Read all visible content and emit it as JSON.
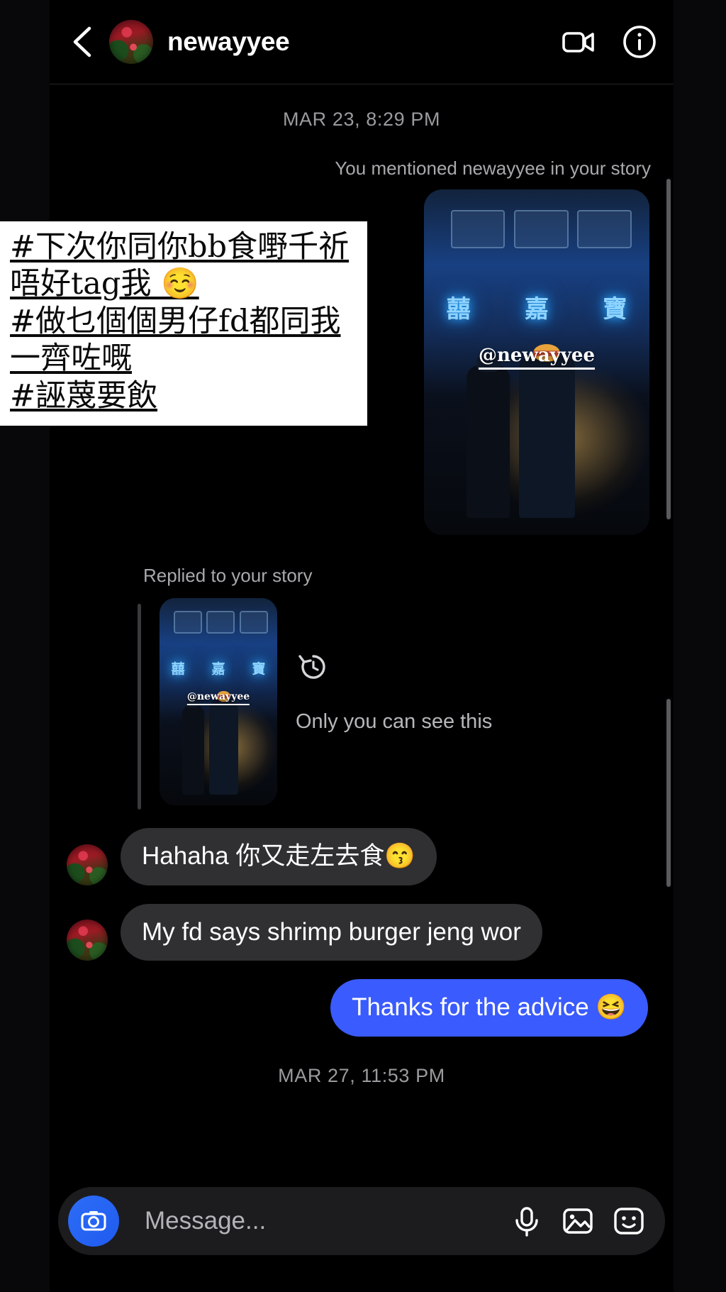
{
  "app": {
    "platform": "instagram-direct-message",
    "background_color": "#000000",
    "accent_color": "#3a5bfd"
  },
  "header": {
    "back_icon": "chevron-left-icon",
    "avatar_icon": "profile-avatar",
    "title": "newayyee",
    "video_call_icon": "video-camera-icon",
    "info_icon": "info-circle-icon"
  },
  "conversation": {
    "day_stamp_top": "MAR 23, 8:29 PM",
    "mention_notice": "You mentioned newayyee in your story",
    "story_card": {
      "sign_chars": [
        "囍",
        "嘉",
        "寶"
      ],
      "tag_sticker": "@newayyee"
    },
    "overlay_caption": {
      "lines": [
        "#下次你同你bb食嘢千祈",
        "唔好tag我 ☺️",
        "#做乜個個男仔fd都同我",
        "一齊咗嘅",
        "#誣蔑要飲"
      ]
    },
    "reply_notice": "Replied to your story",
    "seen_status": "Only you can see this",
    "history_icon": "history-clock-icon",
    "messages": [
      {
        "direction": "in",
        "text": "Hahaha 你又走左去食😙",
        "avatar_icon": "profile-avatar"
      },
      {
        "direction": "in",
        "text": "My fd says shrimp burger jeng wor",
        "avatar_icon": "profile-avatar"
      },
      {
        "direction": "out",
        "text": "Thanks for the advice 😆"
      }
    ],
    "day_stamp_bottom": "MAR 27, 11:53 PM"
  },
  "composer": {
    "camera_icon": "camera-icon",
    "placeholder": "Message...",
    "mic_icon": "microphone-icon",
    "gallery_icon": "photo-gallery-icon",
    "sticker_icon": "sticker-face-icon"
  }
}
